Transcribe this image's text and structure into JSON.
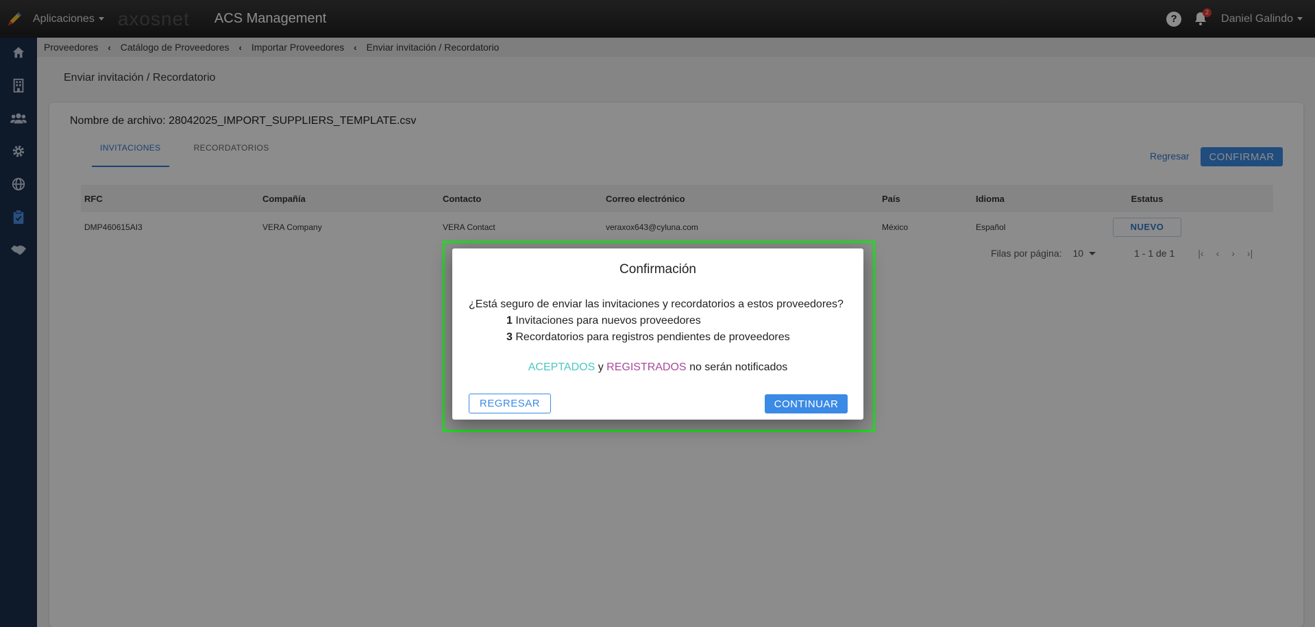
{
  "topbar": {
    "apps_label": "Aplicaciones",
    "brand": "axosnet",
    "app_title": "ACS Management",
    "notifications_count": "2",
    "user_name": "Daniel Galindo"
  },
  "sidebar": {
    "items": [
      "home-icon",
      "building-icon",
      "users-icon",
      "gear-icon",
      "globe-icon",
      "clipboard-icon",
      "handshake-icon"
    ],
    "active_index": 5
  },
  "breadcrumb": [
    "Proveedores",
    "Catálogo de Proveedores",
    "Importar Proveedores",
    "Enviar invitación / Recordatorio"
  ],
  "page_title": "Enviar invitación / Recordatorio",
  "card": {
    "file_name": "Nombre de archivo: 28042025_IMPORT_SUPPLIERS_TEMPLATE.csv",
    "tabs": [
      "INVITACIONES",
      "RECORDATORIOS"
    ],
    "back_label": "Regresar",
    "confirm_label": "CONFIRMAR"
  },
  "table": {
    "headers": [
      "RFC",
      "Compañía",
      "Contacto",
      "Correo electrónico",
      "País",
      "Idioma",
      "Estatus"
    ],
    "rows": [
      [
        "DMP460615AI3",
        "VERA Company",
        "VERA Contact",
        "veraxox643@cyluna.com",
        "México",
        "Español",
        "NUEVO"
      ]
    ]
  },
  "pagination": {
    "rows_per_page_label": "Filas por página:",
    "rows_per_page": "10",
    "range": "1 - 1 de 1"
  },
  "dialog": {
    "title": "Confirmación",
    "question": "¿Está seguro de enviar las invitaciones y recordatorios a estos proveedores?",
    "invitations_count": "1",
    "invitations_text": "Invitaciones para nuevos proveedores",
    "reminders_count": "3",
    "reminders_text": "Recordatorios para registros pendientes de proveedores",
    "accepted": "ACEPTADOS",
    "and": "y",
    "registered": "REGISTRADOS",
    "note_suffix": "no serán notificados",
    "back_button": "REGRESAR",
    "continue_button": "CONTINUAR"
  },
  "colors": {
    "topbar": "#2a2a2a",
    "sidebar": "#1b2f4d",
    "accent": "#3b8ae6",
    "accepted": "#4dc7c0",
    "registered": "#a8499b",
    "highlight": "#19e11c"
  }
}
